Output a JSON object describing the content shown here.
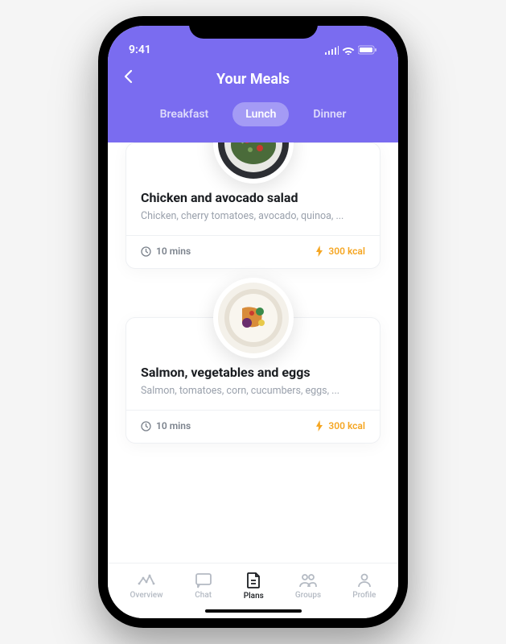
{
  "status": {
    "time": "9:41"
  },
  "header": {
    "title": "Your Meals"
  },
  "tabs": [
    "Breakfast",
    "Lunch",
    "Dinner"
  ],
  "active_tab": "Lunch",
  "meals": [
    {
      "title": "Chicken and avocado salad",
      "ingredients": "Chicken, cherry tomatoes, avocado, quinoa, ...",
      "time": "10 mins",
      "kcal": "300 kcal"
    },
    {
      "title": "Salmon, vegetables and eggs",
      "ingredients": "Salmon, tomatoes, corn, cucumbers, eggs, ...",
      "time": "10 mins",
      "kcal": "300 kcal"
    }
  ],
  "nav": {
    "items": [
      "Overview",
      "Chat",
      "Plans",
      "Groups",
      "Profile"
    ],
    "active": "Plans"
  },
  "icons": {
    "clock": "clock-icon",
    "bolt": "bolt-icon"
  }
}
